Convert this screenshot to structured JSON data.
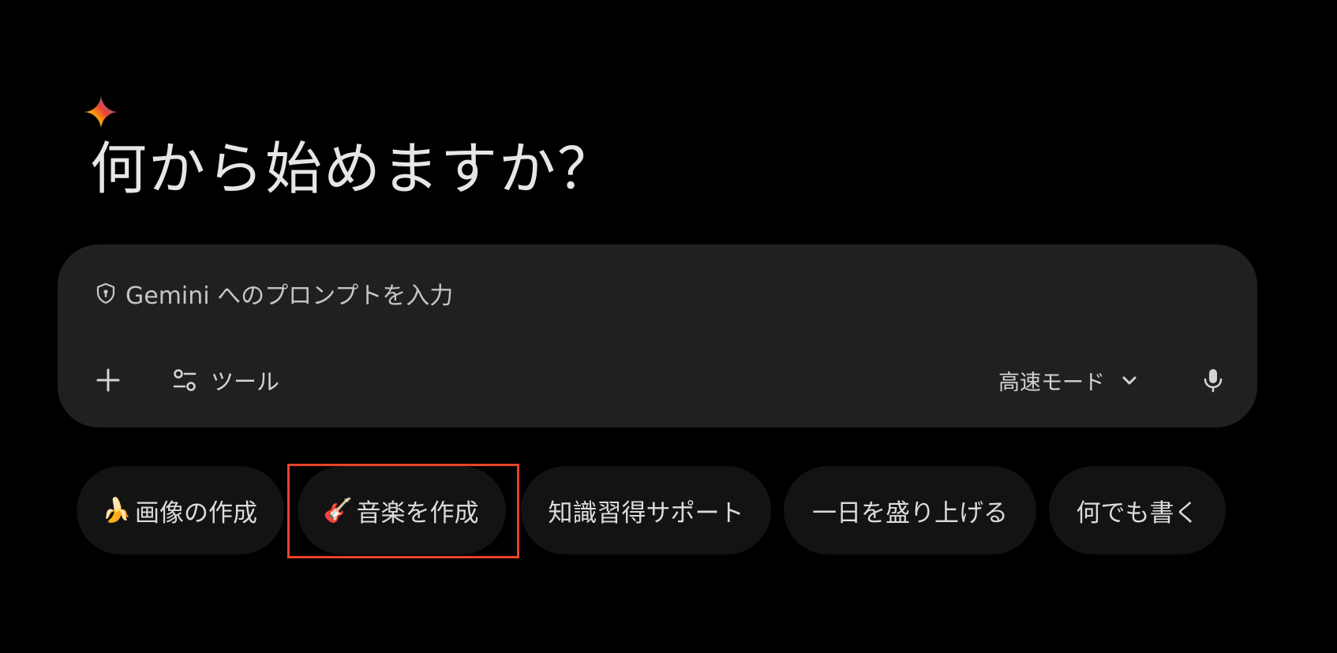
{
  "greeting": {
    "logo_icon": "gemini-spark-icon",
    "title": "何から始めますか？"
  },
  "prompt": {
    "security_icon": "shield-icon",
    "placeholder": "Gemini へのプロンプトを入力",
    "add_icon": "plus-icon",
    "tools_icon": "tune-sliders-icon",
    "tools_label": "ツール",
    "mode_label": "高速モード",
    "mode_dropdown_icon": "chevron-down-icon",
    "mic_icon": "microphone-icon"
  },
  "chips": [
    {
      "emoji": "🍌",
      "icon": "banana-icon",
      "label": "画像の作成"
    },
    {
      "emoji": "🎸",
      "icon": "guitar-icon",
      "label": "音楽を作成"
    },
    {
      "emoji": "",
      "icon": "",
      "label": "知識習得サポート"
    },
    {
      "emoji": "",
      "icon": "",
      "label": "一日を盛り上げる"
    },
    {
      "emoji": "",
      "icon": "",
      "label": "何でも書く"
    }
  ],
  "colors": {
    "background": "#000000",
    "prompt_box": "#1f2022",
    "chip_background": "#131314",
    "highlight_border": "#e8432c",
    "text_primary": "#e3e3e3"
  }
}
